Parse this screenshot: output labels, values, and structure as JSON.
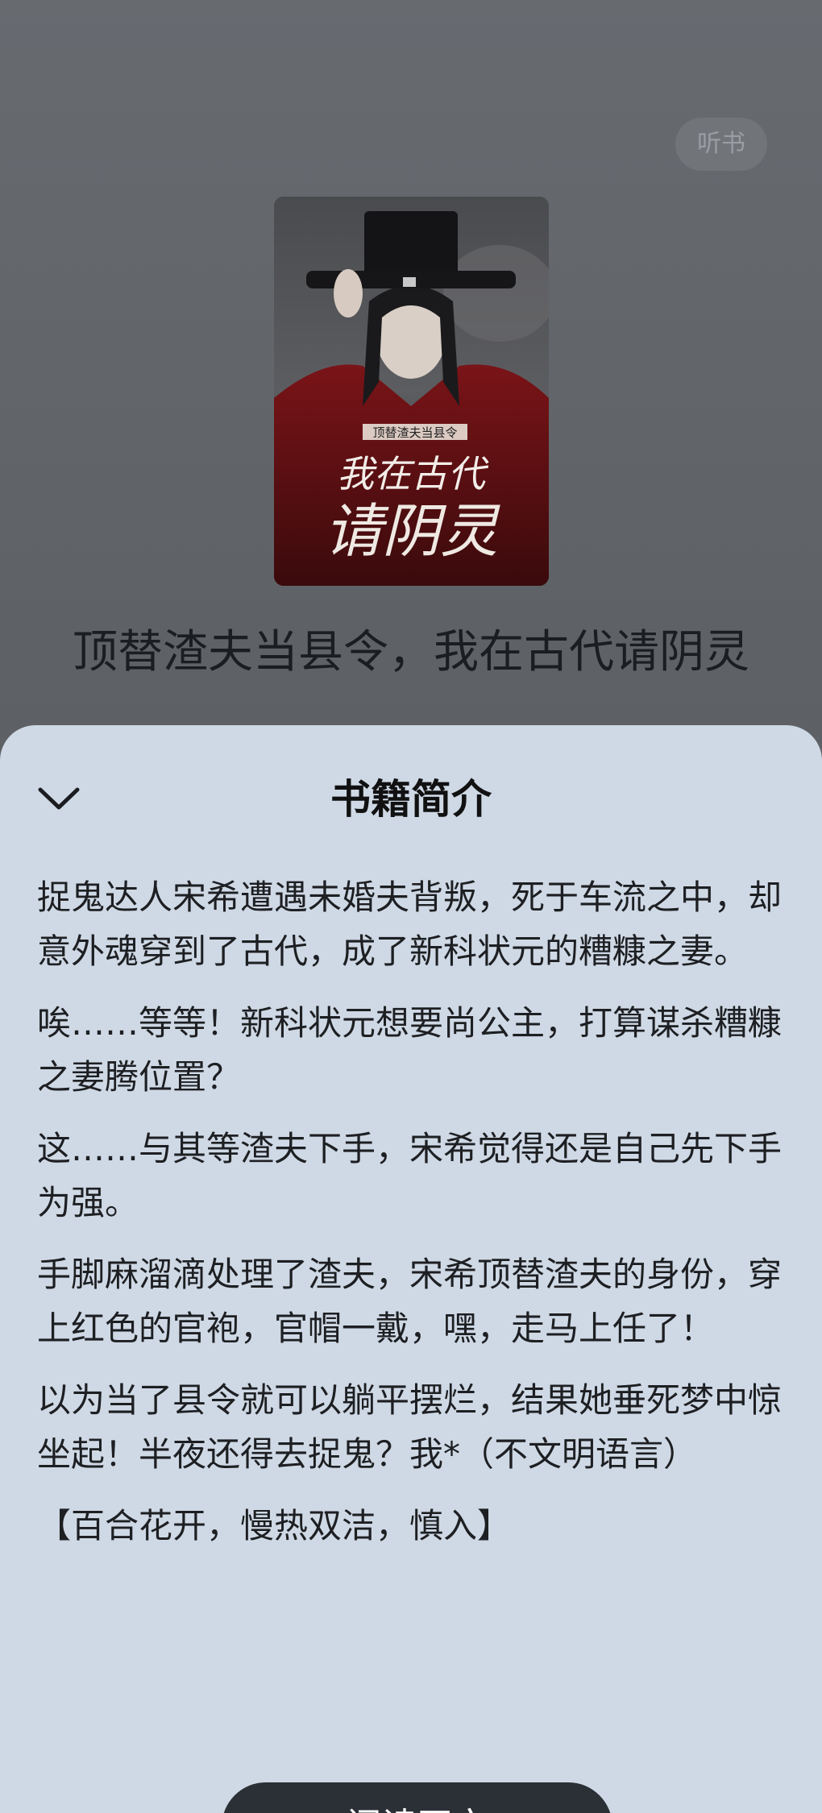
{
  "header": {
    "listen_label": "听书"
  },
  "book": {
    "title": "顶替渣夫当县令，我在古代请阴灵",
    "cover_texts": {
      "small_title": "顶替渣夫当县令",
      "line1": "我在古代",
      "line2": "请阴灵"
    }
  },
  "sheet": {
    "title": "书籍简介",
    "paragraphs": [
      "捉鬼达人宋希遭遇未婚夫背叛，死于车流之中，却意外魂穿到了古代，成了新科状元的糟糠之妻。",
      "唉……等等！新科状元想要尚公主，打算谋杀糟糠之妻腾位置？",
      "这……与其等渣夫下手，宋希觉得还是自己先下手为强。",
      "手脚麻溜滴处理了渣夫，宋希顶替渣夫的身份，穿上红色的官袍，官帽一戴，嘿，走马上任了！",
      "以为当了县令就可以躺平摆烂，结果她垂死梦中惊坐起！半夜还得去捉鬼？我*（不文明语言）",
      "【百合花开，慢热双洁，慎入】"
    ],
    "read_button_label": "阅读正文"
  },
  "colors": {
    "sheet_bg": "#cfd9e5",
    "page_bg": "#5f6367",
    "button_bg": "#2b3036",
    "cover_accent": "#8b1a1f"
  },
  "icons": {
    "collapse": "chevron-down-icon"
  }
}
